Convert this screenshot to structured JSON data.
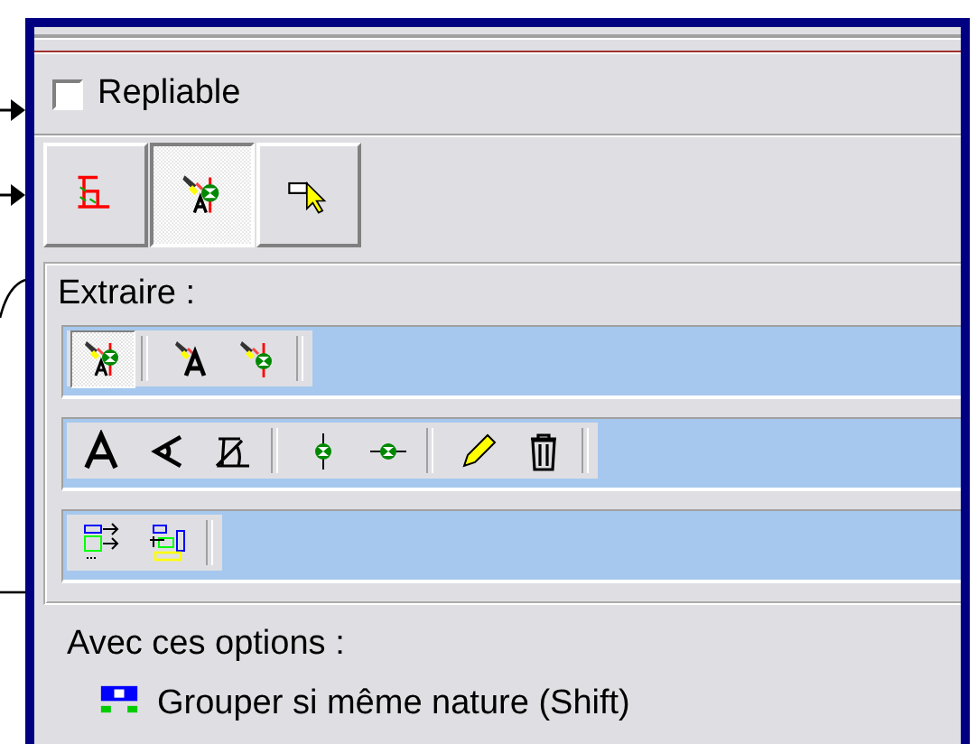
{
  "collapsible": {
    "label": "Repliable",
    "checked": false
  },
  "mode_buttons": [
    {
      "kind": "frame",
      "selected": false
    },
    {
      "kind": "lamp-letter-point",
      "selected": true
    },
    {
      "kind": "pointer",
      "selected": false
    }
  ],
  "extract": {
    "label": "Extraire :",
    "toolbars": [
      [
        [
          {
            "kind": "lamp-letter-point",
            "selected": true
          }
        ],
        [
          {
            "kind": "lamp-letter",
            "selected": false
          },
          {
            "kind": "lamp-point",
            "selected": false
          }
        ]
      ],
      [
        [
          {
            "kind": "letter",
            "selected": false
          },
          {
            "kind": "angle",
            "selected": false
          },
          {
            "kind": "angle-dimension",
            "selected": false
          }
        ],
        [
          {
            "kind": "point",
            "selected": false
          },
          {
            "kind": "point-side",
            "selected": false
          }
        ],
        [
          {
            "kind": "pencil",
            "selected": false
          },
          {
            "kind": "trash",
            "selected": false
          }
        ]
      ],
      [
        [
          {
            "kind": "boxes-arrows",
            "selected": false
          },
          {
            "kind": "boxes",
            "selected": false
          }
        ]
      ]
    ]
  },
  "options": {
    "label": "Avec ces options :",
    "items": [
      {
        "kind": "group-nature",
        "label": "Grouper si même nature (Shift)"
      }
    ]
  }
}
